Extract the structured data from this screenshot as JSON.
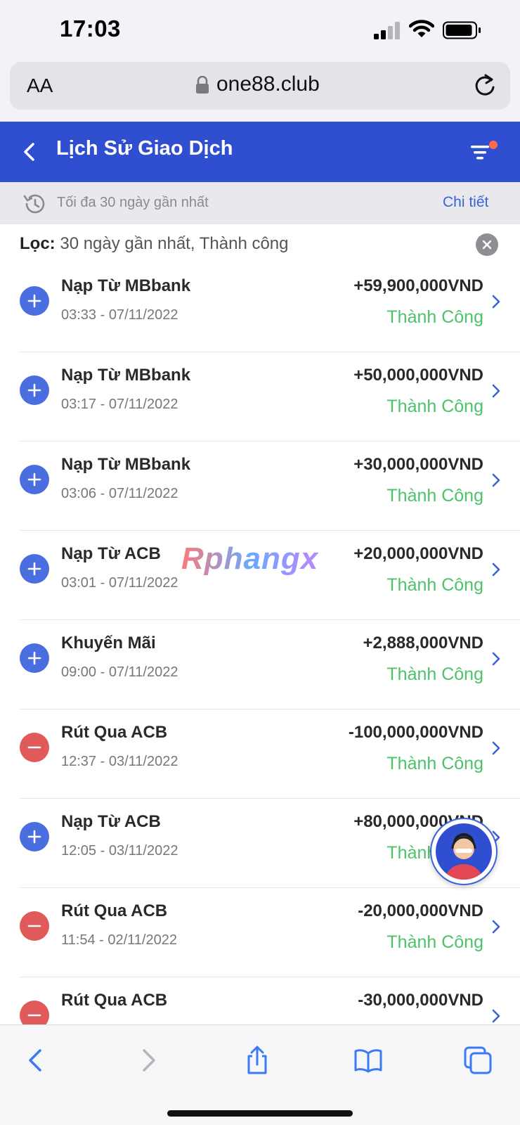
{
  "status_bar": {
    "time": "17:03"
  },
  "browser": {
    "text_size_label": "AA",
    "url": "one88.club"
  },
  "header": {
    "title": "Lịch Sử Giao Dịch"
  },
  "info": {
    "range_text": "Tối đa 30 ngày gần nhất",
    "detail_link": "Chi tiết"
  },
  "filter": {
    "label": "Lọc:",
    "value": "30 ngày gần nhất, Thành công"
  },
  "watermark": "Rphangx",
  "transactions": [
    {
      "type": "plus",
      "title": "Nạp Từ MBbank",
      "time": "03:33 - 07/11/2022",
      "amount": "+59,900,000VND",
      "status": "Thành Công"
    },
    {
      "type": "plus",
      "title": "Nạp Từ MBbank",
      "time": "03:17 - 07/11/2022",
      "amount": "+50,000,000VND",
      "status": "Thành Công"
    },
    {
      "type": "plus",
      "title": "Nạp Từ MBbank",
      "time": "03:06 - 07/11/2022",
      "amount": "+30,000,000VND",
      "status": "Thành Công"
    },
    {
      "type": "plus",
      "title": "Nạp Từ ACB",
      "time": "03:01 - 07/11/2022",
      "amount": "+20,000,000VND",
      "status": "Thành Công"
    },
    {
      "type": "plus",
      "title": "Khuyến Mãi",
      "time": "09:00 - 07/11/2022",
      "amount": "+2,888,000VND",
      "status": "Thành Công"
    },
    {
      "type": "minus",
      "title": "Rút Qua ACB",
      "time": "12:37 - 03/11/2022",
      "amount": "-100,000,000VND",
      "status": "Thành Công"
    },
    {
      "type": "plus",
      "title": "Nạp Từ ACB",
      "time": "12:05 - 03/11/2022",
      "amount": "+80,000,000VND",
      "status": "Thành Công"
    },
    {
      "type": "minus",
      "title": "Rút Qua ACB",
      "time": "11:54 - 02/11/2022",
      "amount": "-20,000,000VND",
      "status": "Thành Công"
    },
    {
      "type": "minus",
      "title": "Rút Qua ACB",
      "time": "",
      "amount": "-30,000,000VND",
      "status": ""
    }
  ],
  "colors": {
    "header": "#2f4fd0",
    "success": "#4cc26a",
    "plus": "#4a6ee0",
    "minus": "#e05a5a",
    "link": "#3a63d8"
  }
}
